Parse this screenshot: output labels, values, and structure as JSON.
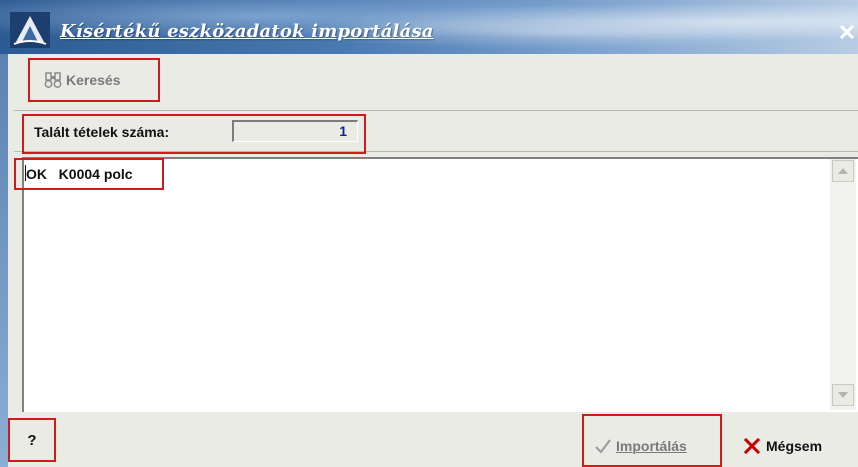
{
  "window": {
    "title": "Kísértékű eszközadatok importálása",
    "close_glyph": "✕"
  },
  "toolbar": {
    "search_label": "Keresés",
    "search_icon": "binoculars-icon"
  },
  "count": {
    "label": "Talált tételek száma:",
    "value": "1"
  },
  "list": {
    "rows": [
      {
        "text": "OK   K0004 polc"
      }
    ]
  },
  "footer": {
    "help_label": "?",
    "import_label": "Importálás",
    "import_icon": "checkmark-icon",
    "cancel_label": "Mégsem",
    "cancel_icon": "x-icon"
  },
  "colors": {
    "highlight": "#d11b1b",
    "count_value": "#0a2a8a",
    "cancel_x": "#c40000",
    "disabled_text": "#7a7a7a"
  }
}
